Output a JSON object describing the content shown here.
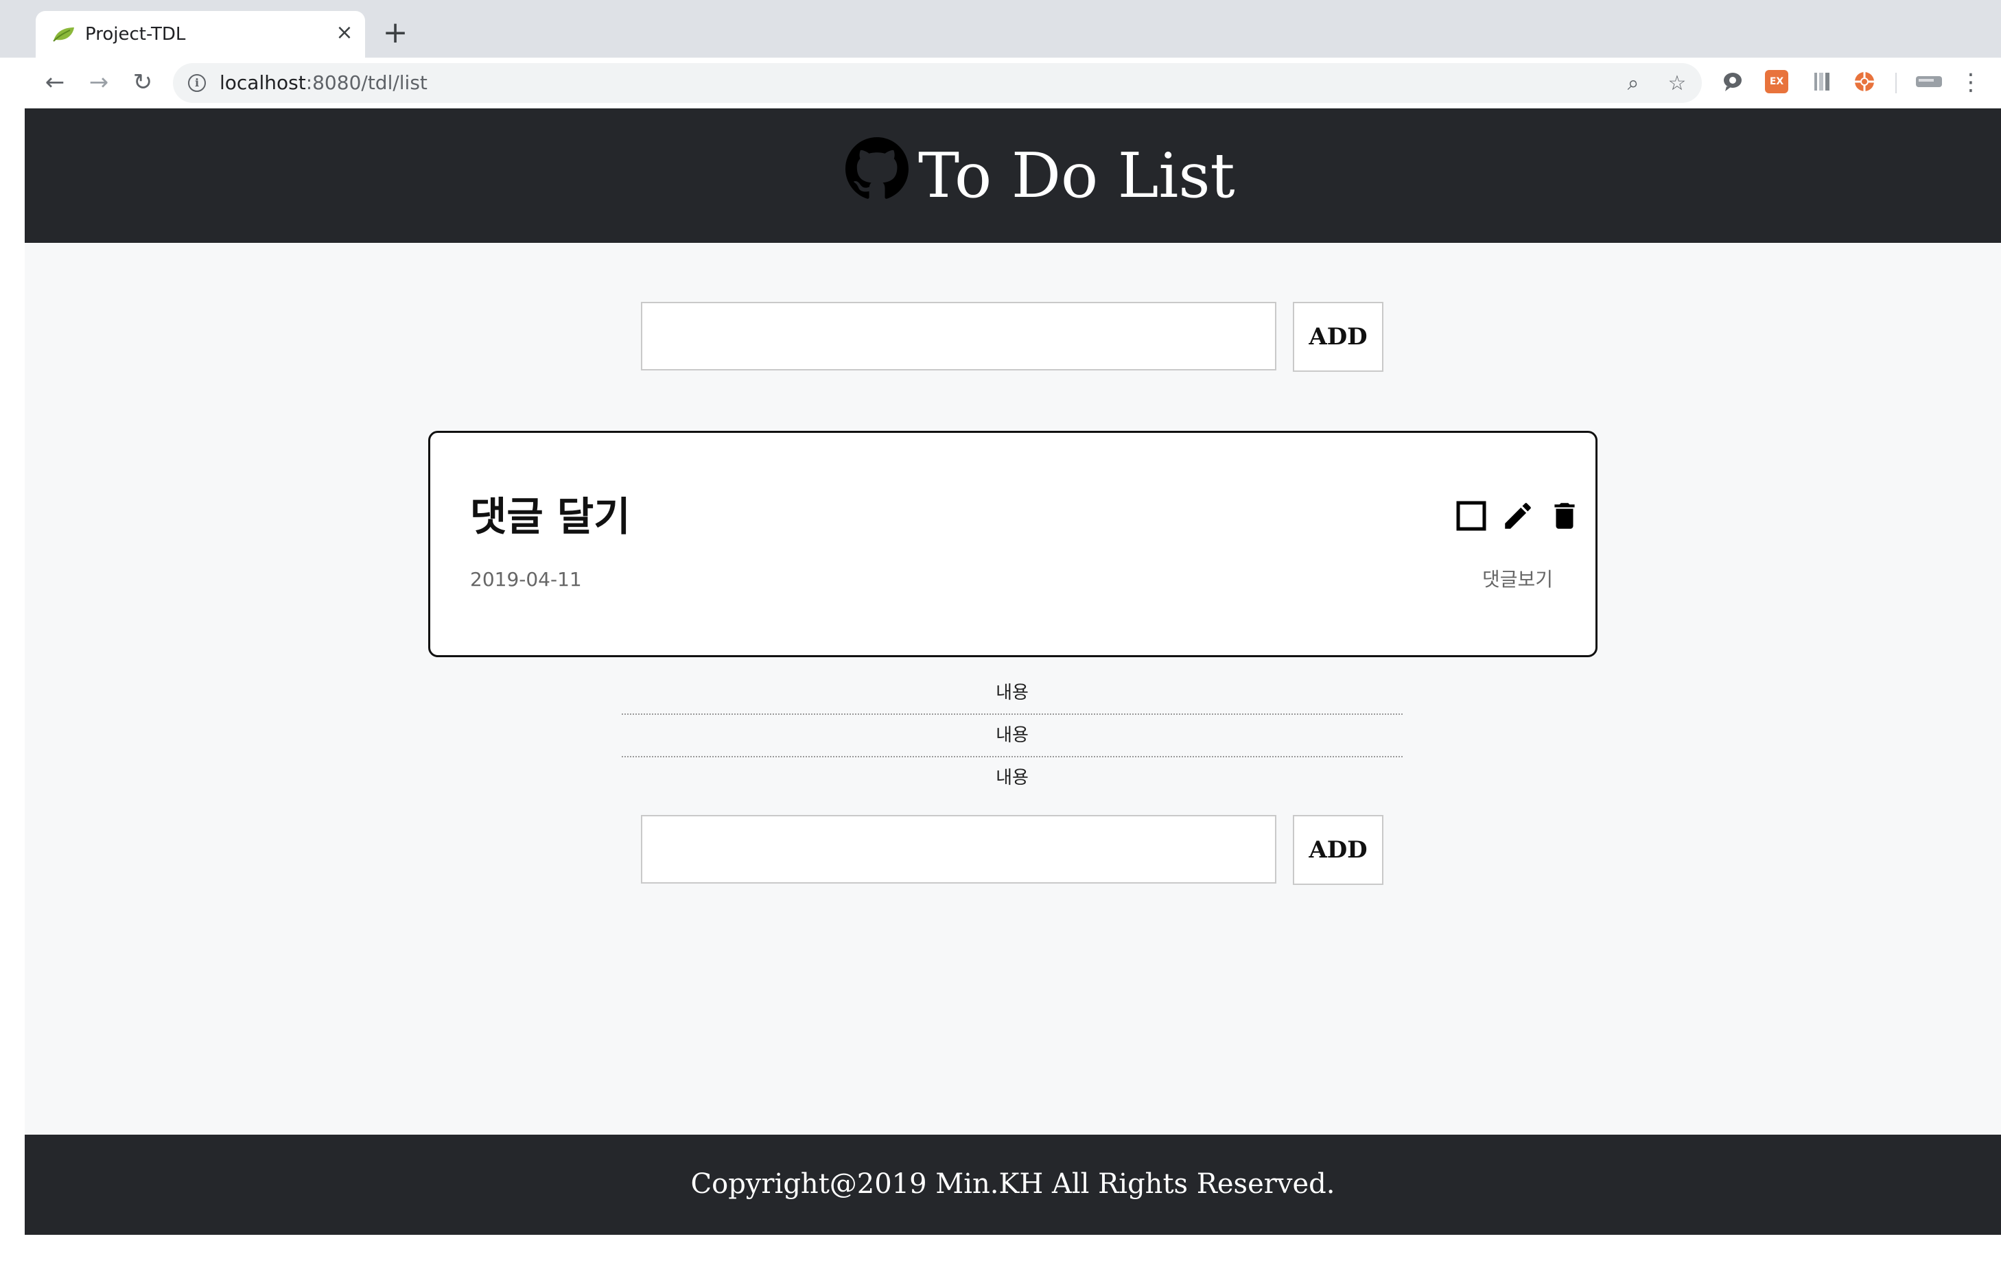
{
  "browser": {
    "tab_title": "Project-TDL",
    "tab_close": "×",
    "new_tab": "+",
    "url_host": "localhost",
    "url_path": ":8080/tdl/list",
    "back": "←",
    "forward": "→",
    "reload": "↻",
    "zoom_icon": "⌕",
    "star_icon": "☆",
    "menu_icon": "⋮",
    "info_icon": "i",
    "extension_label": "EX"
  },
  "header": {
    "title": "To Do List",
    "logo_icon": "github-icon"
  },
  "todo_form": {
    "input_value": "",
    "add_label": "ADD"
  },
  "todo": {
    "title": "댓글 달기",
    "date": "2019-04-11",
    "view_comments": "댓글보기",
    "checked": false
  },
  "comments": [
    {
      "text": "내용"
    },
    {
      "text": "내용"
    },
    {
      "text": "내용"
    }
  ],
  "comment_form": {
    "input_value": "",
    "add_label": "ADD"
  },
  "footer": {
    "text": "Copyright@2019 Min.KH All Rights Reserved."
  },
  "colors": {
    "header_bg": "#25272b",
    "page_bg": "#f7f8f9",
    "card_border": "#111111"
  }
}
